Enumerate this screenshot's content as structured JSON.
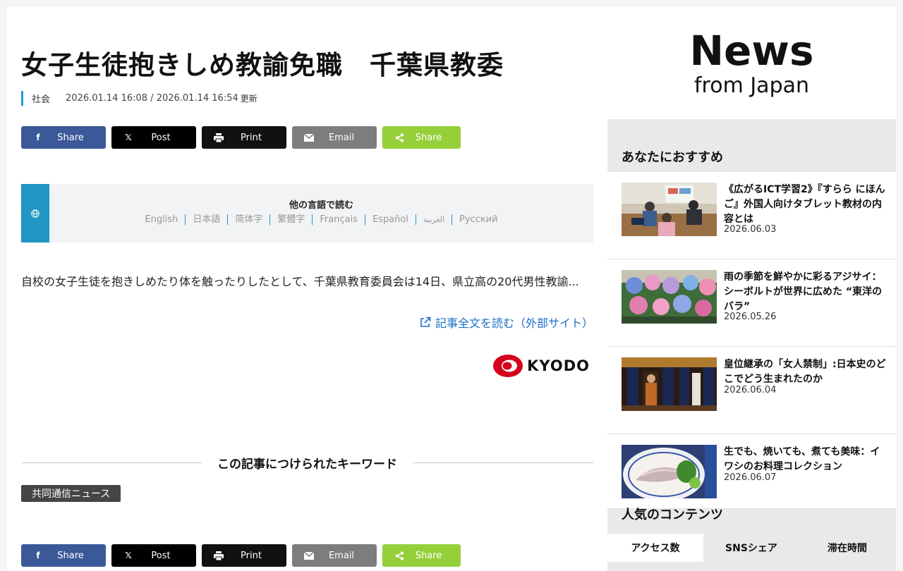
{
  "article": {
    "headline": "女子生徒抱きしめ教諭免職　千葉県教委",
    "category": "社会",
    "dates": "2026.01.14 16:08 / 2026.01.14 16:54",
    "updated_label": "更新",
    "body": "自校の女子生徒を抱きしめたり体を触ったりしたとして、千葉県教育委員会は14日、県立高の20代男性教諭...",
    "read_more": "記事全文を読む（外部サイト）",
    "source_logo_text": "KYODO"
  },
  "share": {
    "facebook": "Share",
    "x": "Post",
    "print": "Print",
    "email": "Email",
    "share": "Share"
  },
  "languages": {
    "title": "他の言語で読む",
    "items": [
      "English",
      "日本語",
      "简体字",
      "繁體字",
      "Français",
      "Español",
      "العربية",
      "Русский"
    ]
  },
  "keywords": {
    "heading": "この記事につけられたキーワード",
    "tags": [
      "共同通信ニュース"
    ]
  },
  "sidebar": {
    "brand_line1": "News",
    "brand_line2": "from Japan",
    "recommended_title": "あなたにおすすめ",
    "recommended": [
      {
        "title": "《広がるICT学習2》『すらら にほんご』外国人向けタブレット教材の内容とは",
        "date": "2026.06.03"
      },
      {
        "title": "雨の季節を鮮やかに彩るアジサイ：シーボルトが世界に広めた “東洋のバラ”",
        "date": "2026.05.26"
      },
      {
        "title": "皇位継承の「女人禁制」:日本史のどこでどう生まれたのか",
        "date": "2026.06.04"
      },
      {
        "title": "生でも、焼いても、煮ても美味：イワシのお料理コレクション",
        "date": "2026.06.07"
      }
    ],
    "popular_title": "人気のコンテンツ",
    "tabs": [
      "アクセス数",
      "SNSシェア",
      "滞在時間"
    ]
  },
  "colors": {
    "accent": "#1e9dd8",
    "facebook": "#3b5998",
    "share_green": "#95d03a",
    "link": "#1a6fc9"
  }
}
